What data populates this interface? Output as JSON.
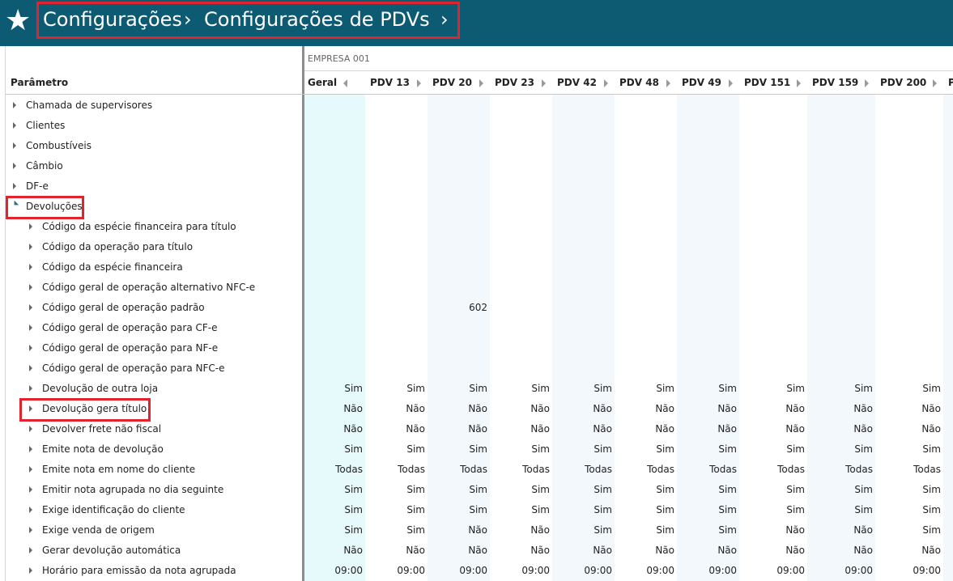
{
  "header": {
    "crumbs": [
      "Configurações",
      "Configurações de PDVs"
    ],
    "colors": {
      "topbar": "#0d5a73",
      "highlight": "#e0232d"
    },
    "star_icon": "star-icon"
  },
  "grid": {
    "group_label": "EMPRESA 001",
    "param_header": "Parâmetro",
    "columns": [
      "Geral",
      "PDV 13",
      "PDV 20",
      "PDV 23",
      "PDV 42",
      "PDV 48",
      "PDV 49",
      "PDV 151",
      "PDV 159",
      "PDV 200",
      "P"
    ],
    "rows": [
      {
        "label": "Chamada de supervisores",
        "level": 0,
        "state": "collapsed",
        "values": []
      },
      {
        "label": "Clientes",
        "level": 0,
        "state": "collapsed",
        "values": []
      },
      {
        "label": "Combustíveis",
        "level": 0,
        "state": "collapsed",
        "values": []
      },
      {
        "label": "Câmbio",
        "level": 0,
        "state": "collapsed",
        "values": []
      },
      {
        "label": "DF-e",
        "level": 0,
        "state": "collapsed",
        "values": []
      },
      {
        "label": "Devoluções",
        "level": 0,
        "state": "expanded",
        "highlighted": true,
        "values": []
      },
      {
        "label": "Código da espécie financeira para título",
        "level": 1,
        "state": "collapsed",
        "values": []
      },
      {
        "label": "Código da operação para título",
        "level": 1,
        "state": "collapsed",
        "values": []
      },
      {
        "label": "Código da espécie financeira",
        "level": 1,
        "state": "collapsed",
        "values": []
      },
      {
        "label": "Código geral de operação alternativo NFC-e",
        "level": 1,
        "state": "collapsed",
        "values": []
      },
      {
        "label": "Código geral de operação padrão",
        "level": 1,
        "state": "collapsed",
        "values": [
          "",
          "",
          "602",
          "",
          "",
          "",
          "",
          "",
          "",
          ""
        ]
      },
      {
        "label": "Código geral de operação para CF-e",
        "level": 1,
        "state": "collapsed",
        "values": []
      },
      {
        "label": "Código geral de operação para NF-e",
        "level": 1,
        "state": "collapsed",
        "values": []
      },
      {
        "label": "Código geral de operação para NFC-e",
        "level": 1,
        "state": "collapsed",
        "values": []
      },
      {
        "label": "Devolução de outra loja",
        "level": 1,
        "state": "collapsed",
        "values": [
          "Sim",
          "Sim",
          "Sim",
          "Sim",
          "Sim",
          "Sim",
          "Sim",
          "Sim",
          "Sim",
          "Sim"
        ]
      },
      {
        "label": "Devolução gera título",
        "level": 1,
        "state": "collapsed",
        "highlighted": true,
        "values": [
          "Não",
          "Não",
          "Não",
          "Não",
          "Não",
          "Não",
          "Não",
          "Não",
          "Não",
          "Não"
        ]
      },
      {
        "label": "Devolver frete não fiscal",
        "level": 1,
        "state": "collapsed",
        "values": [
          "Não",
          "Não",
          "Não",
          "Não",
          "Não",
          "Não",
          "Não",
          "Não",
          "Não",
          "Não"
        ]
      },
      {
        "label": "Emite nota de devolução",
        "level": 1,
        "state": "collapsed",
        "values": [
          "Sim",
          "Sim",
          "Sim",
          "Sim",
          "Sim",
          "Sim",
          "Sim",
          "Sim",
          "Sim",
          "Sim"
        ]
      },
      {
        "label": "Emite nota em nome do cliente",
        "level": 1,
        "state": "collapsed",
        "values": [
          "Todas",
          "Todas",
          "Todas",
          "Todas",
          "Todas",
          "Todas",
          "Todas",
          "Todas",
          "Todas",
          "Todas"
        ]
      },
      {
        "label": "Emitir nota agrupada no dia seguinte",
        "level": 1,
        "state": "collapsed",
        "values": [
          "Sim",
          "Sim",
          "Sim",
          "Sim",
          "Sim",
          "Sim",
          "Sim",
          "Sim",
          "Sim",
          "Sim"
        ]
      },
      {
        "label": "Exige identificação do cliente",
        "level": 1,
        "state": "collapsed",
        "values": [
          "Sim",
          "Sim",
          "Sim",
          "Sim",
          "Sim",
          "Sim",
          "Sim",
          "Sim",
          "Sim",
          "Sim"
        ]
      },
      {
        "label": "Exige venda de origem",
        "level": 1,
        "state": "collapsed",
        "values": [
          "Sim",
          "Sim",
          "Não",
          "Não",
          "Sim",
          "Sim",
          "Sim",
          "Não",
          "Não",
          "Sim"
        ]
      },
      {
        "label": "Gerar devolução automática",
        "level": 1,
        "state": "collapsed",
        "values": [
          "Não",
          "Não",
          "Não",
          "Não",
          "Não",
          "Não",
          "Não",
          "Não",
          "Não",
          "Não"
        ]
      },
      {
        "label": "Horário para emissão da nota agrupada",
        "level": 1,
        "state": "collapsed",
        "values": [
          "09:00",
          "09:00",
          "09:00",
          "09:00",
          "09:00",
          "09:00",
          "09:00",
          "09:00",
          "09:00",
          "09:00"
        ]
      }
    ]
  }
}
